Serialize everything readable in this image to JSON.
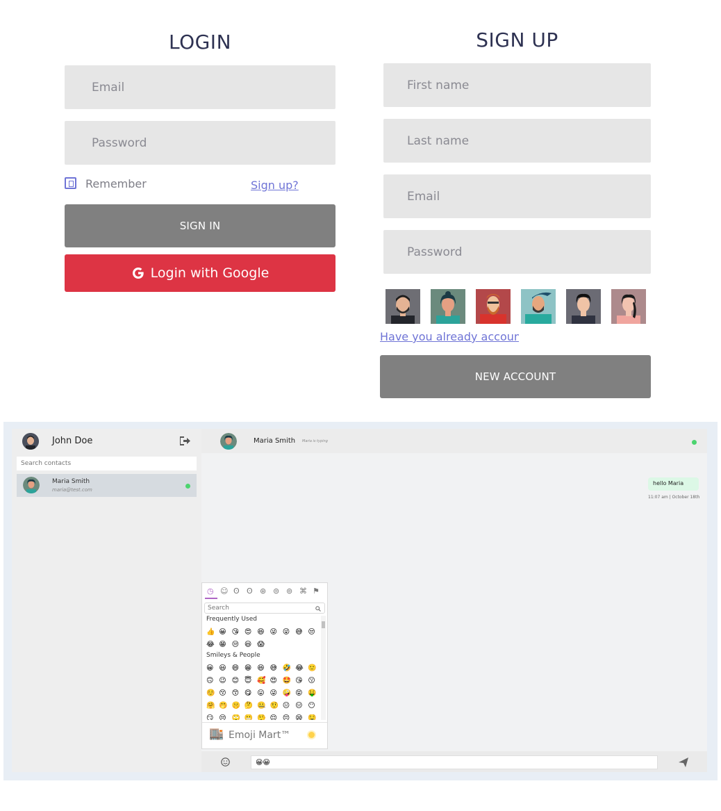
{
  "login": {
    "title": "LOGIN",
    "email_placeholder": "Email",
    "password_placeholder": "Password",
    "remember_label": "Remember",
    "signup_link": "Sign up?",
    "signin_button": "SIGN IN",
    "google_button": "Login with Google"
  },
  "signup": {
    "title": "SIGN UP",
    "first_name_placeholder": "First name",
    "last_name_placeholder": "Last name",
    "email_placeholder": "Email",
    "password_placeholder": "Password",
    "avatars": [
      "avatar-bearded-man",
      "avatar-woman-teal",
      "avatar-red-hair-man",
      "avatar-blue-hair-man",
      "avatar-dark-hair-man",
      "avatar-woman-pink"
    ],
    "already_account_link": "Have you already account?",
    "new_account_button": "NEW ACCOUNT"
  },
  "chat": {
    "user_name": "John Doe",
    "search_placeholder": "Search contacts",
    "contacts": [
      {
        "name": "Maria Smith",
        "email": "maria@test.com",
        "online": true
      }
    ],
    "header_name": "Maria Smith",
    "typing_status": "Maria is typing",
    "messages": [
      {
        "text": "hello Maria",
        "time": "11:07 am | October 18th"
      }
    ],
    "input_value": "😀😀"
  },
  "emoji_mart": {
    "search_placeholder": "Search",
    "frequently_used_label": "Frequently Used",
    "smileys_label": "Smileys & People",
    "footer_label": "Emoji Mart™",
    "frequently_used": [
      "👍",
      "😀",
      "😘",
      "😍",
      "😆",
      "😜",
      "😜",
      "😅",
      "😒",
      "😂",
      "😁",
      "😒",
      "😃",
      "😱"
    ],
    "smileys_rows": [
      [
        "😀",
        "😃",
        "😄",
        "😁",
        "😆",
        "😅",
        "🤣",
        "😂",
        "🙂"
      ],
      [
        "🙃",
        "😉",
        "😊",
        "😇",
        "🥰",
        "😍",
        "🤩",
        "😘",
        "😗"
      ],
      [
        "☺️",
        "😚",
        "😙",
        "😋",
        "😛",
        "😜",
        "🤪",
        "😝",
        "🤑"
      ],
      [
        "🤗",
        "🤭",
        "🤫",
        "🤔",
        "🤐",
        "🤨",
        "😐",
        "😑",
        "😶"
      ],
      [
        "😏",
        "😒",
        "🙄",
        "😬",
        "🤥",
        "😌",
        "😔",
        "😪",
        "🤤"
      ]
    ],
    "categories": [
      "clock-icon",
      "smiley-icon",
      "animal-icon",
      "food-icon",
      "activity-icon",
      "travel-icon",
      "objects-icon",
      "symbols-icon",
      "flags-icon"
    ]
  },
  "colors": {
    "accent": "#6f74d6",
    "google_red": "#dd3444",
    "grey_button": "#808080",
    "online_green": "#4cd46f",
    "message_bubble": "#dcf8e6"
  }
}
